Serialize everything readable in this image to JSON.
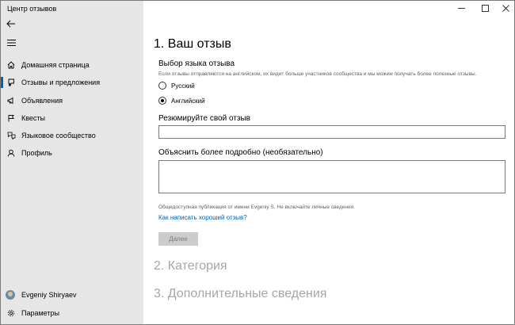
{
  "window": {
    "title": "Центр отзывов"
  },
  "sidebar": {
    "items": [
      {
        "label": "Домашняя страница",
        "icon": "home-icon"
      },
      {
        "label": "Отзывы и предложения",
        "icon": "feedback-icon"
      },
      {
        "label": "Объявления",
        "icon": "megaphone-icon"
      },
      {
        "label": "Квесты",
        "icon": "quest-icon"
      },
      {
        "label": "Языковое сообщество",
        "icon": "language-icon"
      },
      {
        "label": "Профиль",
        "icon": "profile-icon"
      }
    ],
    "active_index": 1,
    "user_name": "Evgeniy Shiryaev",
    "settings_label": "Параметры"
  },
  "main": {
    "step1_title": "1. Ваш отзыв",
    "language_section_title": "Выбор языка отзыва",
    "language_hint": "Если отзывы отправляются на английском, их видит больше участников сообщества и мы можем получать более полезные отзывы.",
    "language_options": [
      {
        "label": "Русский",
        "checked": false
      },
      {
        "label": "Английский",
        "checked": true
      }
    ],
    "summary_label": "Резюмируйте свой отзыв",
    "summary_value": "",
    "details_label": "Объяснить более подробно (необязательно)",
    "details_value": "",
    "public_note": "Общедоступная публикация от имени Evgeniy S. Не включайте личные сведения.",
    "help_link": "Как написать хороший отзыв?",
    "next_button": "Далее",
    "step2_title": "2. Категория",
    "step3_title": "3. Дополнительные сведения"
  },
  "colors": {
    "accent": "#0063b1",
    "sidebar_bg": "#e6e6e6",
    "disabled_heading": "#a6a6a6"
  }
}
